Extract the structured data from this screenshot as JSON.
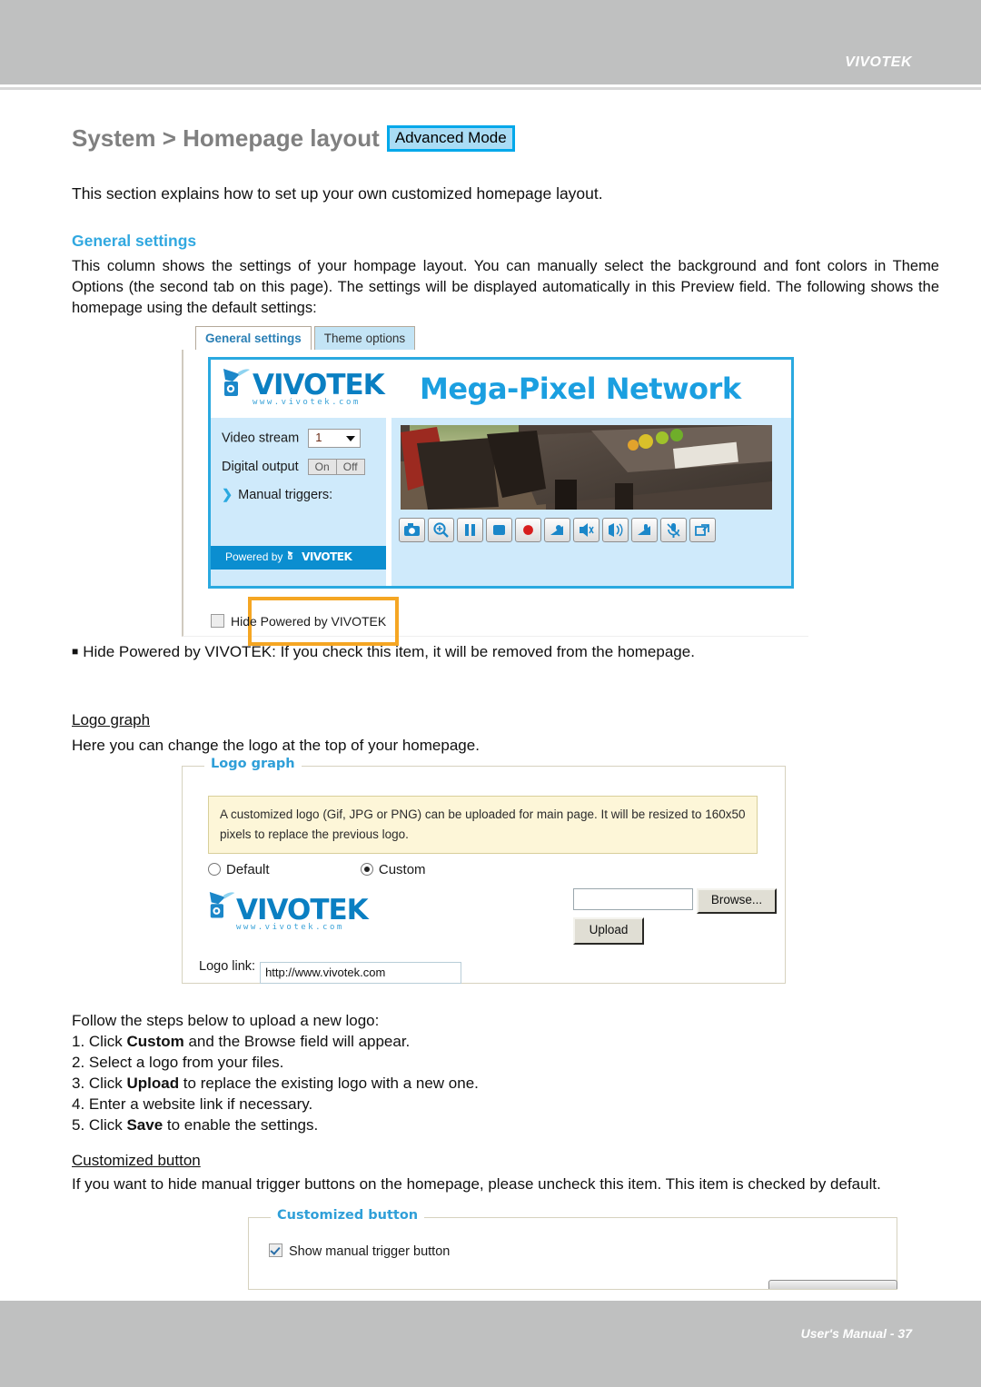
{
  "header": {
    "brand": "VIVOTEK"
  },
  "footer": {
    "text": "User's Manual - 37"
  },
  "title": {
    "text": "System > Homepage layout",
    "badge": "Advanced Mode"
  },
  "intro": "This section explains how to set up your own customized homepage layout.",
  "general_settings": {
    "heading": "General settings",
    "body": "This column shows the settings of your hompage layout. You can manually select the background and font colors in Theme Options (the second tab on this page). The settings will be displayed automatically in this Preview field. The following shows the homepage using the default settings:",
    "tabs": [
      {
        "label": "General settings",
        "active": true
      },
      {
        "label": "Theme options",
        "active": false
      }
    ],
    "preview": {
      "logo_word": "VIVOTEK",
      "logo_url": "www.vivotek.com",
      "banner_title": "Mega-Pixel Network",
      "video_stream_label": "Video stream",
      "video_stream_value": "1",
      "digital_output_label": "Digital output",
      "digital_output_on": "On",
      "digital_output_off": "Off",
      "manual_triggers_label": "Manual triggers:",
      "powered_by": "Powered by",
      "powered_logo": "VIVOTEK",
      "toolbar_icons": [
        "snapshot-icon",
        "digital-zoom-icon",
        "pause-icon",
        "stop-icon",
        "record-icon",
        "volume-icon",
        "mute-icon",
        "speaker-icon",
        "talk-icon",
        "mic-icon",
        "fullscreen-icon"
      ]
    },
    "hide_powered_label": "Hide Powered by VIVOTEK",
    "hide_powered_checked": false
  },
  "hide_note": "Hide Powered by VIVOTEK: If you check this item, it will be removed from the homepage.",
  "logo_graph": {
    "heading": "Logo graph",
    "body": "Here you can change the logo at the top of your homepage.",
    "legend": "Logo graph",
    "note": "A customized logo (Gif, JPG or PNG) can be uploaded for main page. It will be resized to 160x50 pixels to replace the previous logo.",
    "option_default": "Default",
    "option_custom": "Custom",
    "selected_option": "Custom",
    "file_value": "",
    "browse_label": "Browse...",
    "upload_label": "Upload",
    "logo_link_label": "Logo link:",
    "logo_link_value": "http://www.vivotek.com",
    "logo_word": "VIVOTEK",
    "logo_url": "www.vivotek.com"
  },
  "steps": {
    "intro": "Follow the steps below to upload a new logo:",
    "items": [
      {
        "num": "1. ",
        "pre": "Click ",
        "bold": "Custom",
        "post": " and the Browse field will appear."
      },
      {
        "num": "2. ",
        "pre": "Select a logo from your files.",
        "bold": "",
        "post": ""
      },
      {
        "num": "3. ",
        "pre": "Click ",
        "bold": "Upload",
        "post": " to replace the existing logo with a new one."
      },
      {
        "num": "4. ",
        "pre": "Enter a website link if necessary.",
        "bold": "",
        "post": ""
      },
      {
        "num": "5. ",
        "pre": "Click ",
        "bold": "Save",
        "post": " to enable the settings."
      }
    ]
  },
  "customized_button": {
    "heading": "Customized button",
    "body": "If you want to hide manual trigger buttons on the homepage, please uncheck this item. This item is checked by default.",
    "legend": "Customized button",
    "checkbox_label": "Show manual trigger button",
    "checked": true
  },
  "colors": {
    "header_gray": "#bfc0c0",
    "accent_blue": "#31a8e0",
    "badge_border": "#00a8ea",
    "badge_fill": "#a9dcf5",
    "highlight_orange": "#f5a623",
    "note_yellow": "#fdf6d8"
  }
}
